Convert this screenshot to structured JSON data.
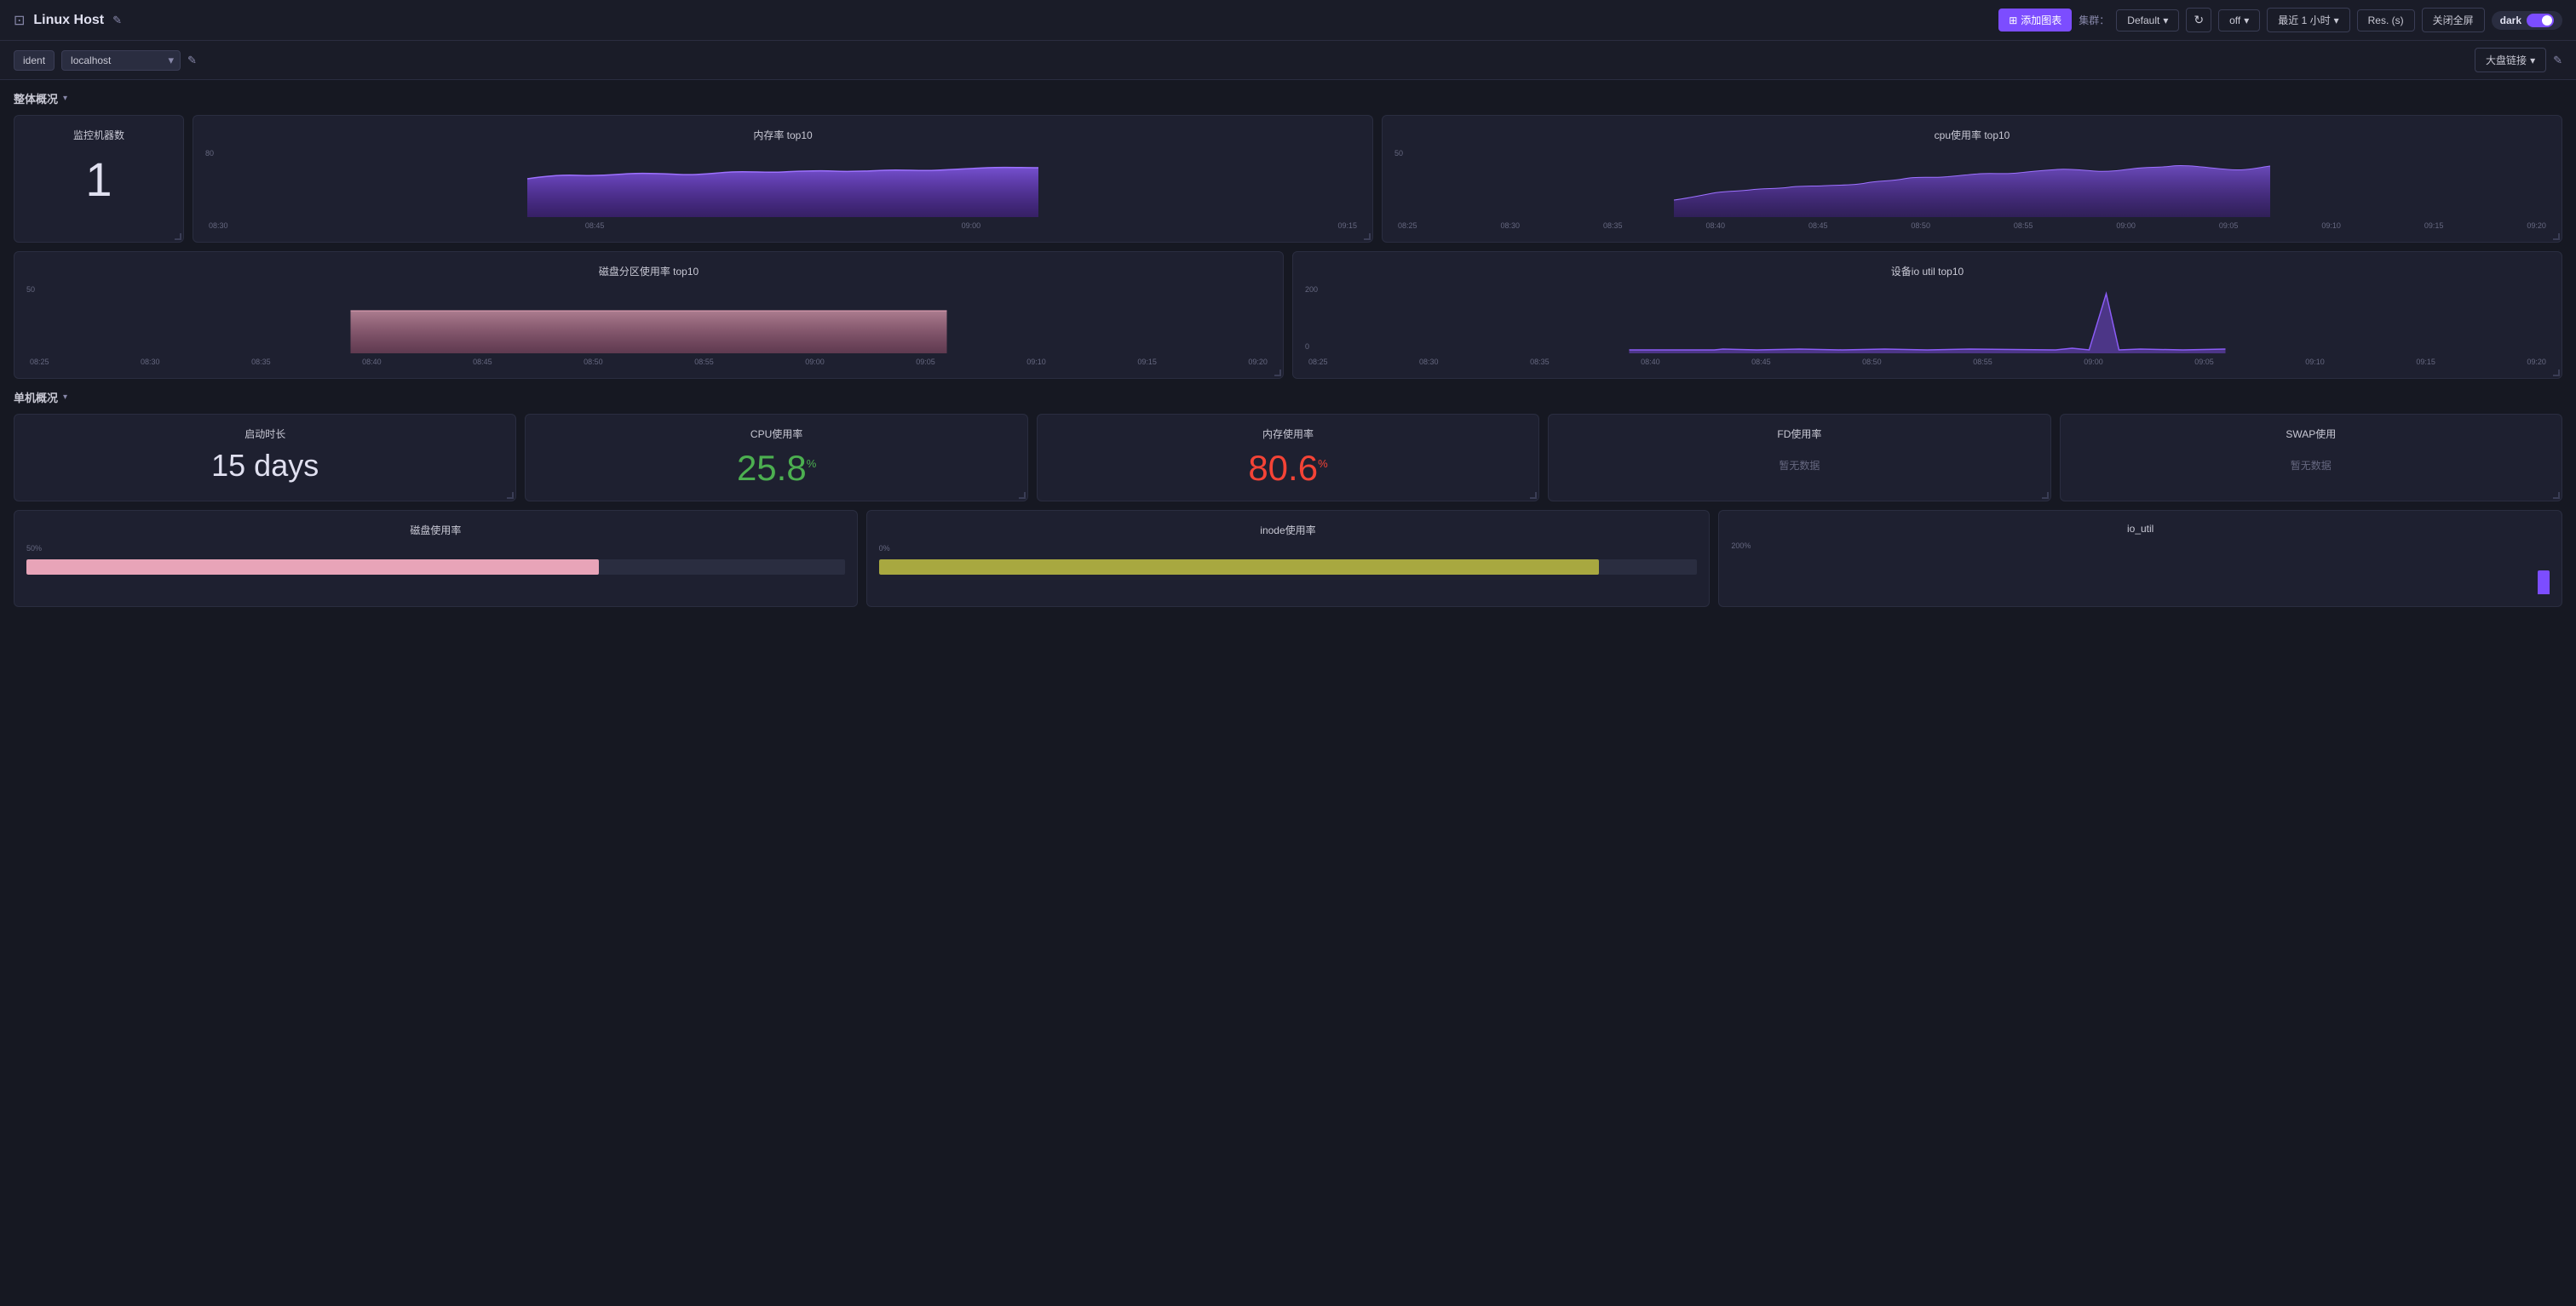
{
  "header": {
    "title": "Linux Host",
    "add_chart_label": "添加图表",
    "cluster_label": "集群：",
    "cluster_value": "Default",
    "refresh_off": "off",
    "time_range": "最近 1 小时",
    "res_label": "Res. (s)",
    "close_full": "关闭全屏",
    "theme": "dark",
    "dashboard_link": "大盘链接"
  },
  "toolbar": {
    "ident_label": "ident",
    "host_value": "localhost",
    "host_placeholder": "localhost"
  },
  "sections": {
    "overall": {
      "title": "整体概况",
      "panels": {
        "monitor_count": {
          "title": "监控机器数",
          "value": "1"
        },
        "mem_top10": {
          "title": "内存率 top10",
          "y_max": "80",
          "y_min": "0",
          "times": [
            "08:30",
            "08:45",
            "09:00",
            "09:15"
          ]
        },
        "cpu_top10": {
          "title": "cpu使用率 top10",
          "y_max": "50",
          "y_min": "0",
          "times": [
            "08:25",
            "08:30",
            "08:35",
            "08:40",
            "08:45",
            "08:50",
            "08:55",
            "09:00",
            "09:05",
            "09:10",
            "09:15",
            "09:20"
          ]
        },
        "disk_top10": {
          "title": "磁盘分区使用率 top10",
          "y_max": "50",
          "y_min": "0",
          "times": [
            "08:25",
            "08:30",
            "08:35",
            "08:40",
            "08:45",
            "08:50",
            "08:55",
            "09:00",
            "09:05",
            "09:10",
            "09:15",
            "09:20"
          ]
        },
        "io_util_top10": {
          "title": "设备io util top10",
          "y_max": "200",
          "y_min": "0",
          "times": [
            "08:25",
            "08:30",
            "08:35",
            "08:40",
            "08:45",
            "08:50",
            "08:55",
            "09:00",
            "09:05",
            "09:10",
            "09:15",
            "09:20"
          ]
        }
      }
    },
    "single": {
      "title": "单机概况",
      "panels": {
        "uptime": {
          "title": "启动时长",
          "value": "15 days"
        },
        "cpu_usage": {
          "title": "CPU使用率",
          "value": "25.8",
          "unit": "%"
        },
        "mem_usage": {
          "title": "内存使用率",
          "value": "80.6",
          "unit": "%"
        },
        "fd_usage": {
          "title": "FD使用率",
          "no_data": "暂无数据"
        },
        "swap": {
          "title": "SWAP使用",
          "no_data": "暂无数据"
        },
        "disk_usage": {
          "title": "磁盘使用率",
          "pct": "50%"
        },
        "inode_usage": {
          "title": "inode使用率",
          "pct": "0%"
        },
        "io_util": {
          "title": "io_util",
          "pct": "200%"
        }
      }
    }
  }
}
